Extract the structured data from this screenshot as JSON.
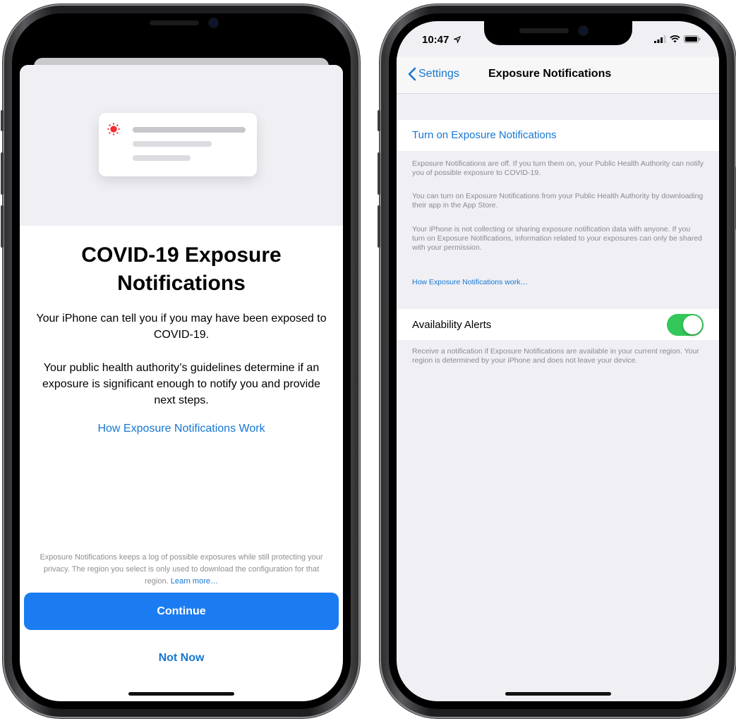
{
  "left_phone": {
    "title": "COVID-19 Exposure Notifications",
    "paragraph1": "Your iPhone can tell you if you may have been exposed to COVID-19.",
    "paragraph2": "Your public health authority’s guidelines determine if an exposure is significant enough to notify you and provide next steps.",
    "how_link": "How Exposure Notifications Work",
    "fine_print": "Exposure Notifications keeps a log of possible exposures while still protecting your privacy. The region you select is only used to download the configuration for that region.",
    "learn_more": "Learn more…",
    "continue_label": "Continue",
    "not_now_label": "Not Now",
    "icon": "virus-icon",
    "accent_color": "#1b7cf2"
  },
  "right_phone": {
    "status": {
      "time": "10:47",
      "icons": [
        "location-arrow-icon",
        "signal-icon",
        "wifi-icon",
        "battery-icon"
      ]
    },
    "nav": {
      "back_label": "Settings",
      "title": "Exposure Notifications"
    },
    "turn_on_label": "Turn on Exposure Notifications",
    "footnotes": [
      "Exposure Notifications are off. If you turn them on, your Public Health Authority can notify you of possible exposure to COVID-19.",
      "You can turn on Exposure Notifications from your Public Health Authority by downloading their app in the App Store.",
      "Your iPhone is not collecting or sharing exposure notification data with anyone. If you turn on Exposure Notifications, information related to your exposures can only be shared with your permission."
    ],
    "how_link": "How Exposure Notifications work…",
    "availability": {
      "label": "Availability Alerts",
      "enabled": true,
      "footnote": "Receive a notification if Exposure Notifications are available in your current region. Your region is determined by your iPhone and does not leave your device."
    },
    "toggle_color": "#34c759"
  }
}
